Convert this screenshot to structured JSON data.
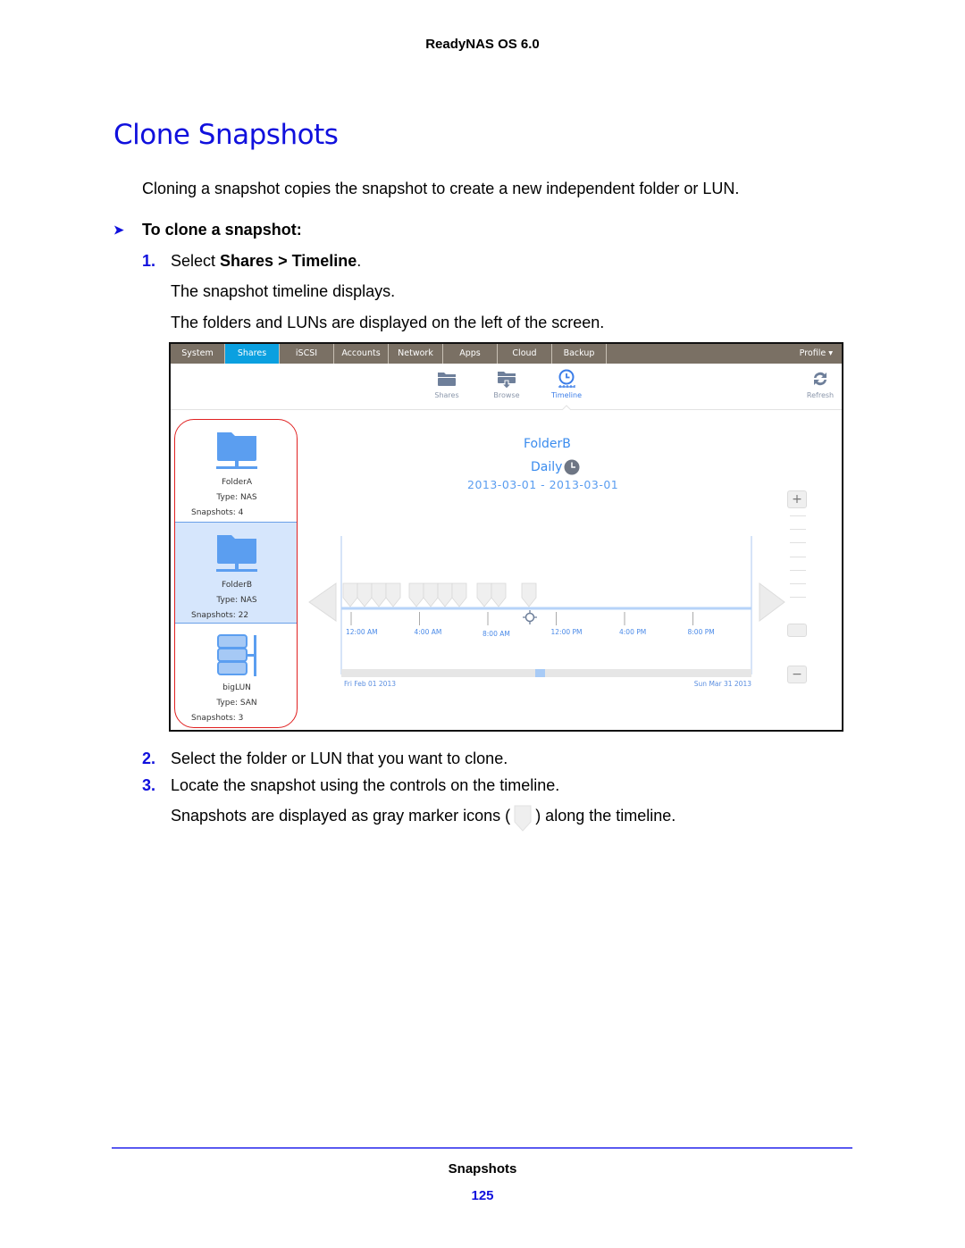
{
  "header": {
    "running_title": "ReadyNAS OS 6.0"
  },
  "title": "Clone Snapshots",
  "intro": "Cloning a snapshot copies the snapshot to create a new independent folder or LUN.",
  "procedure": {
    "heading": "To clone a snapshot:",
    "steps": [
      {
        "num": "1.",
        "pre": "Select ",
        "bold": "Shares > Timeline",
        "post": "."
      },
      {
        "num": "2.",
        "text": "Select the folder or LUN that you want to clone."
      },
      {
        "num": "3.",
        "text": "Locate the snapshot using the controls on the timeline."
      }
    ],
    "step1_notes": [
      "The snapshot timeline displays.",
      "The folders and LUNs are displayed on the left of the screen."
    ],
    "step3_note_pre": "Snapshots are displayed as gray marker icons (",
    "step3_note_post": ") along the timeline."
  },
  "screenshot": {
    "nav_tabs": [
      "System",
      "Shares",
      "iSCSI",
      "Accounts",
      "Network",
      "Apps",
      "Cloud",
      "Backup"
    ],
    "active_tab": "Shares",
    "profile_label": "Profile ▾",
    "subnav": [
      {
        "label": "Shares",
        "icon": "folder-icon",
        "active": false
      },
      {
        "label": "Browse",
        "icon": "browse-icon",
        "active": false
      },
      {
        "label": "Timeline",
        "icon": "clock-icon",
        "active": true
      }
    ],
    "refresh_label": "Refresh",
    "volumes": [
      {
        "name": "FolderA",
        "type_label": "Type:  NAS",
        "snapshots_label": "Snapshots:  4",
        "icon": "folder-network-icon",
        "selected": false
      },
      {
        "name": "FolderB",
        "type_label": "Type:  NAS",
        "snapshots_label": "Snapshots:  22",
        "icon": "folder-network-icon",
        "selected": true
      },
      {
        "name": "bigLUN",
        "type_label": "Type:  SAN",
        "snapshots_label": "Snapshots:  3",
        "icon": "lun-icon",
        "selected": false
      }
    ],
    "timeline": {
      "title": "FolderB",
      "frequency": "Daily",
      "date_range": "2013-03-01  -  2013-03-01",
      "time_ticks": [
        "12:00 AM",
        "4:00 AM",
        "8:00 AM",
        "12:00 PM",
        "4:00 PM",
        "8:00 PM"
      ],
      "overview_start": "Fri Feb 01 2013",
      "overview_end": "Sun Mar 31 2013",
      "marker_groups": [
        4,
        4,
        2,
        1
      ],
      "zoom_in_label": "+",
      "zoom_out_label": "−"
    }
  },
  "footer": {
    "section": "Snapshots",
    "page_number": "125"
  },
  "colors": {
    "heading_blue": "#1010dd",
    "nav_bg": "#7a7064",
    "nav_active": "#0aa0e0",
    "accent_blue": "#3b8cee",
    "highlight": "#e02020"
  }
}
